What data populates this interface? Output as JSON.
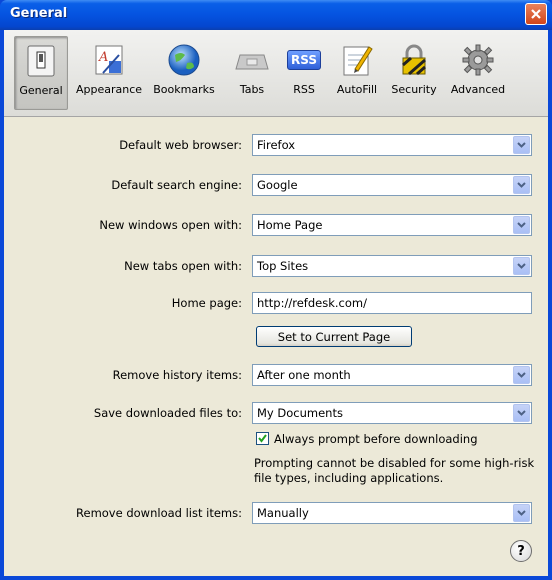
{
  "window": {
    "title": "General"
  },
  "toolbar": {
    "items": [
      {
        "label": "General",
        "icon": "general-switch-icon",
        "selected": true
      },
      {
        "label": "Appearance",
        "icon": "appearance-icon",
        "selected": false
      },
      {
        "label": "Bookmarks",
        "icon": "globe-icon",
        "selected": false
      },
      {
        "label": "Tabs",
        "icon": "tabs-icon",
        "selected": false
      },
      {
        "label": "RSS",
        "icon": "rss-icon",
        "badge": "RSS",
        "selected": false
      },
      {
        "label": "AutoFill",
        "icon": "pencil-pad-icon",
        "selected": false
      },
      {
        "label": "Security",
        "icon": "lock-icon",
        "selected": false
      },
      {
        "label": "Advanced",
        "icon": "gear-icon",
        "selected": false
      }
    ]
  },
  "form": {
    "default_browser": {
      "label": "Default web browser:",
      "value": "Firefox"
    },
    "search_engine": {
      "label": "Default search engine:",
      "value": "Google"
    },
    "new_windows": {
      "label": "New windows open with:",
      "value": "Home Page"
    },
    "new_tabs": {
      "label": "New tabs open with:",
      "value": "Top Sites"
    },
    "home_page": {
      "label": "Home page:",
      "value": "http://refdesk.com/"
    },
    "set_current_button": "Set to Current Page",
    "remove_history": {
      "label": "Remove history items:",
      "value": "After one month"
    },
    "save_downloads": {
      "label": "Save downloaded files to:",
      "value": "My Documents"
    },
    "always_prompt": {
      "label": "Always prompt before downloading",
      "checked": true
    },
    "prompt_note": "Prompting cannot be disabled for some high-risk file types, including applications.",
    "remove_download": {
      "label": "Remove download list items:",
      "value": "Manually"
    }
  },
  "help": {
    "label": "?"
  },
  "colors": {
    "titlebar": "#0553e0",
    "client": "#ece9d8",
    "select_border": "#7f9db9"
  }
}
